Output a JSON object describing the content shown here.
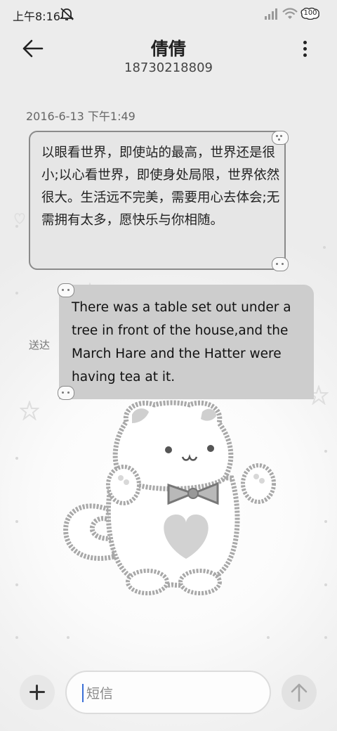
{
  "status_bar": {
    "time": "上午8:16",
    "battery": "100",
    "icons": [
      "mute-icon",
      "signal-icon",
      "wifi-icon",
      "battery-icon"
    ]
  },
  "header": {
    "contact_name": "倩倩",
    "contact_number": "18730218809",
    "icons": [
      "back-arrow-icon",
      "more-vertical-icon"
    ]
  },
  "conversation": {
    "timestamp": "2016-6-13 下午1:49",
    "messages": [
      {
        "direction": "incoming",
        "text": "以眼看世界，即使站的最高，世界还是很小;以心看世界，即使身处局限，世界依然很大。生活远不完美，需要用心去体会;无需拥有太多，愿快乐与你相随。"
      },
      {
        "direction": "outgoing",
        "text": "There was a table set out under a tree in front of the house,and the March Hare and the Hatter were having tea at it.",
        "status": "送达"
      }
    ]
  },
  "composer": {
    "placeholder": "短信",
    "value": "",
    "icons": [
      "plus-icon",
      "send-arrow-icon"
    ]
  },
  "colors": {
    "incoming_bubble": "#e6e6e6",
    "outgoing_bubble": "#cdcdcd",
    "caret": "#3b6fd6"
  }
}
